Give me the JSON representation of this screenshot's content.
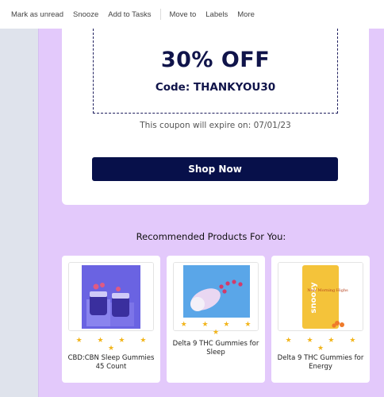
{
  "toolbar": {
    "mark_unread": "Mark as unread",
    "snooze": "Snooze",
    "add_to_tasks": "Add to Tasks",
    "move_to": "Move to",
    "labels": "Labels",
    "more": "More"
  },
  "coupon": {
    "discount": "30% OFF",
    "code": "Code: THANKYOU30",
    "expire": "This coupon will expire on: 07/01/23"
  },
  "cta": {
    "shop_now": "Shop Now"
  },
  "recommended": {
    "title": "Recommended Products For You:",
    "products": [
      {
        "name": "CBD:CBN Sleep Gummies 45 Count",
        "rating": "★ ★ ★ ★ ★"
      },
      {
        "name": "Delta 9 THC Gummies for Sleep",
        "rating": "★ ★ ★ ★ ★"
      },
      {
        "name": "Delta 9 THC Gummies for Energy",
        "rating": "★ ★ ★ ★ ★",
        "pouch_brand": "snoozy",
        "pouch_tagline": "New Morning Highs"
      }
    ]
  },
  "colors": {
    "email_background": "#e3c9fb",
    "button": "#07104a",
    "stars": "#f2b51c"
  }
}
